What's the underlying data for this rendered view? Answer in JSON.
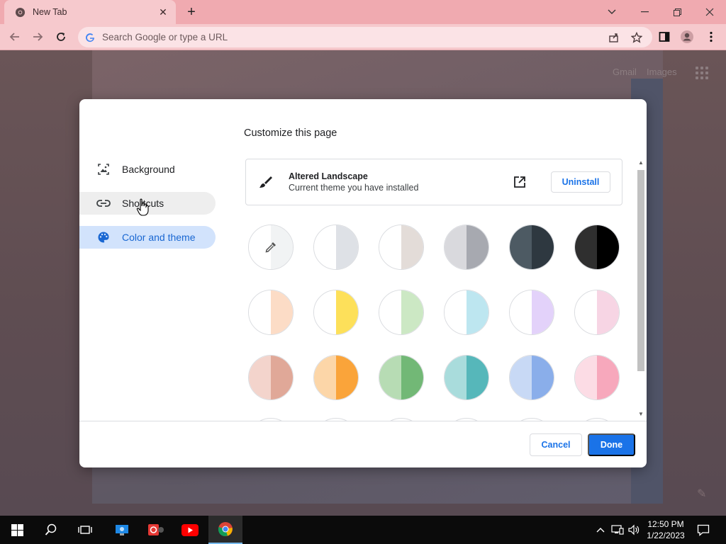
{
  "browser": {
    "tab_title": "New Tab",
    "omnibox_placeholder": "Search Google or type a URL"
  },
  "page": {
    "links": [
      "Gmail",
      "Images"
    ]
  },
  "dialog": {
    "title": "Customize this page",
    "menu": [
      {
        "label": "Background",
        "icon": "image-icon",
        "state": "normal"
      },
      {
        "label": "Shortcuts",
        "icon": "link-icon",
        "state": "hover"
      },
      {
        "label": "Color and theme",
        "icon": "palette-icon",
        "state": "active"
      }
    ],
    "theme": {
      "name": "Altered Landscape",
      "subtitle": "Current theme you have installed",
      "uninstall_label": "Uninstall"
    },
    "swatches": [
      {
        "left": "#ffffff",
        "right": "#f1f3f4",
        "custom": true
      },
      {
        "left": "#ffffff",
        "right": "#dee1e6"
      },
      {
        "left": "#ffffff",
        "right": "#e3dcd8"
      },
      {
        "left": "#d9d9dd",
        "right": "#a7a9b0"
      },
      {
        "left": "#4d5a63",
        "right": "#2e3840"
      },
      {
        "left": "#2f2f2f",
        "right": "#000000"
      },
      {
        "left": "#ffffff",
        "right": "#fcdcc6"
      },
      {
        "left": "#ffffff",
        "right": "#fde05a"
      },
      {
        "left": "#ffffff",
        "right": "#cce8c4"
      },
      {
        "left": "#ffffff",
        "right": "#bde6f0"
      },
      {
        "left": "#ffffff",
        "right": "#e3d2fa"
      },
      {
        "left": "#ffffff",
        "right": "#f7d5e4"
      },
      {
        "left": "#f3d4cc",
        "right": "#e0a898"
      },
      {
        "left": "#fcd6a8",
        "right": "#faa43a"
      },
      {
        "left": "#b7dcb4",
        "right": "#72b876"
      },
      {
        "left": "#a9dcdc",
        "right": "#56b7ba"
      },
      {
        "left": "#c8d9f5",
        "right": "#8aaeea"
      },
      {
        "left": "#fcdce5",
        "right": "#f7a8bc"
      }
    ],
    "cancel_label": "Cancel",
    "done_label": "Done"
  },
  "taskbar": {
    "time": "12:50 PM",
    "date": "1/22/2023"
  }
}
